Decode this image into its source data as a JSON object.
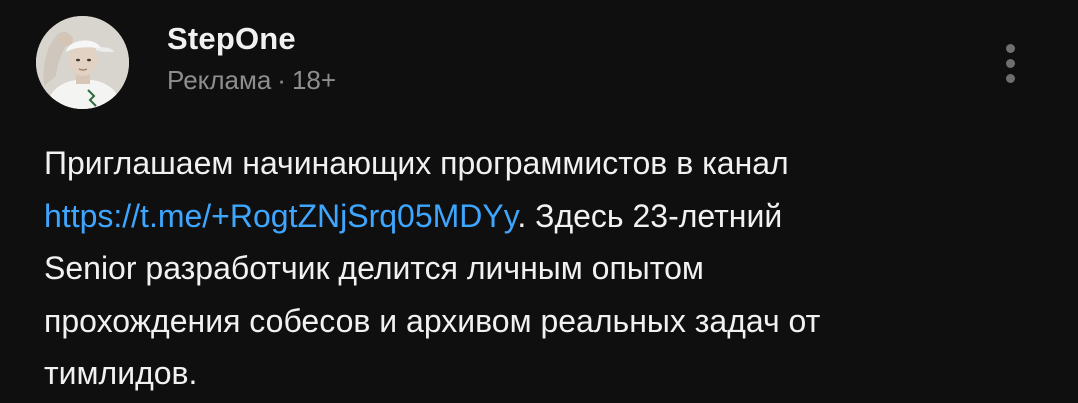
{
  "post": {
    "channel_name": "StepOne",
    "ad_label": "Реклама",
    "separator": "·",
    "age_rating": "18+",
    "menu_icon": "more-vert-icon",
    "text": {
      "line1": "Приглашаем начинающих программистов в канал",
      "link": "https://t.me/+RogtZNjSrq05MDYy",
      "line2_after_link": ". Здесь 23-летний",
      "line3": "Senior разработчик делится личным опытом",
      "line4": "прохождения собесов и архивом реальных задач от",
      "line5": "тимлидов."
    }
  },
  "colors": {
    "background": "#0f0f0f",
    "text_primary": "#f1f1f1",
    "text_secondary": "#8e8e8e",
    "link": "#3ea6ff",
    "icon": "#6f6f6f"
  }
}
